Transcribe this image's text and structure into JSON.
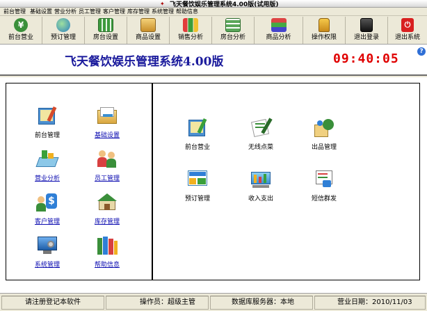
{
  "window": {
    "title": "飞天餐饮娱乐管理系统4.00版(试用版)"
  },
  "menu": [
    "前台管理",
    "基础设置",
    "营业分析",
    "员工管理",
    "客户管理",
    "库存管理",
    "系统管理",
    "帮助信息"
  ],
  "toolbar": [
    {
      "label": "前台营业",
      "icon": "cashier-icon"
    },
    {
      "label": "预订管理",
      "icon": "booking-globe-icon"
    },
    {
      "label": "房台设置",
      "icon": "room-grid-icon"
    },
    {
      "label": "商品设置",
      "icon": "goods-box-icon"
    },
    {
      "label": "销售分析",
      "icon": "sales-chart-icon"
    },
    {
      "label": "房台分析",
      "icon": "room-chart-icon"
    },
    {
      "label": "商品分析",
      "icon": "goods-books-icon"
    },
    {
      "label": "操作权限",
      "icon": "lock-icon"
    },
    {
      "label": "退出登录",
      "icon": "logout-pc-icon"
    },
    {
      "label": "退出系统",
      "icon": "power-icon"
    }
  ],
  "banner": {
    "title": "飞天餐饮娱乐管理系统4.00版",
    "clock": "09:40:05"
  },
  "left_panel": [
    {
      "label": "前台管理",
      "link": false,
      "icon": "frontdesk-notebook-icon"
    },
    {
      "label": "基础设置",
      "link": true,
      "icon": "settings-folder-icon"
    },
    {
      "label": "营业分析",
      "link": true,
      "icon": "business-analysis-icon"
    },
    {
      "label": "员工管理",
      "link": true,
      "icon": "staff-people-icon"
    },
    {
      "label": "客户管理",
      "link": true,
      "icon": "customer-dollar-icon"
    },
    {
      "label": "库存管理",
      "link": true,
      "icon": "warehouse-house-icon"
    },
    {
      "label": "系统管理",
      "link": true,
      "icon": "system-monitor-icon"
    },
    {
      "label": "帮助信息",
      "link": true,
      "icon": "help-books-icon"
    }
  ],
  "right_panel": [
    {
      "label": "前台营业",
      "icon": "frontdesk-business-icon"
    },
    {
      "label": "无线点菜",
      "icon": "wireless-order-icon"
    },
    {
      "label": "出品管理",
      "icon": "output-management-icon"
    },
    {
      "label": "预订管理",
      "icon": "reservation-board-icon"
    },
    {
      "label": "收入支出",
      "icon": "income-expense-icon"
    },
    {
      "label": "短信群发",
      "icon": "sms-broadcast-icon"
    }
  ],
  "status": {
    "register": "请注册登记本软件",
    "operator": "操作员：超级主管",
    "db_server": "数据库服务器：本地",
    "business_date": "营业日期：2010/11/03"
  },
  "colors": {
    "title_blue": "#1a1a9c",
    "clock_red": "#e00000",
    "link_blue": "#0b0bb0"
  }
}
